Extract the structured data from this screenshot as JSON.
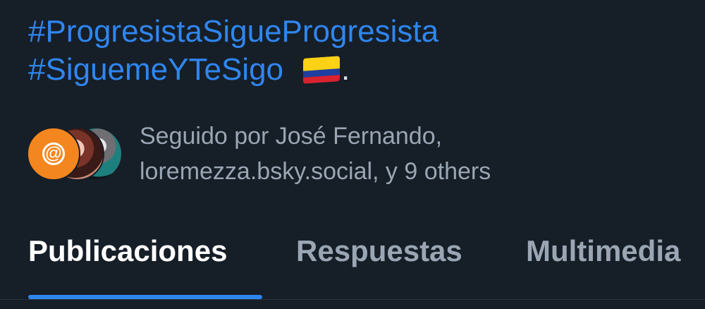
{
  "profile": {
    "bio_hashtag_1": "#ProgresistaSigueProgresista",
    "bio_hashtag_2": "#SiguemeYTeSigo",
    "bio_flag": "colombia-flag-icon",
    "bio_end": "."
  },
  "followers": {
    "text_line_1": "Seguido por José Fernando,",
    "text_line_2": "loremezza.bsky.social, y 9 others",
    "avatar_1_symbol": "@"
  },
  "tabs": [
    {
      "label": "Publicaciones",
      "active": true
    },
    {
      "label": "Respuestas",
      "active": false
    },
    {
      "label": "Multimedia",
      "active": false
    }
  ],
  "colors": {
    "background": "#161e27",
    "link": "#2f86f0",
    "muted_text": "#9aa6b4",
    "active_tab": "#ffffff",
    "tab_indicator": "#2f86f0",
    "avatar_orange": "#f4861f"
  }
}
